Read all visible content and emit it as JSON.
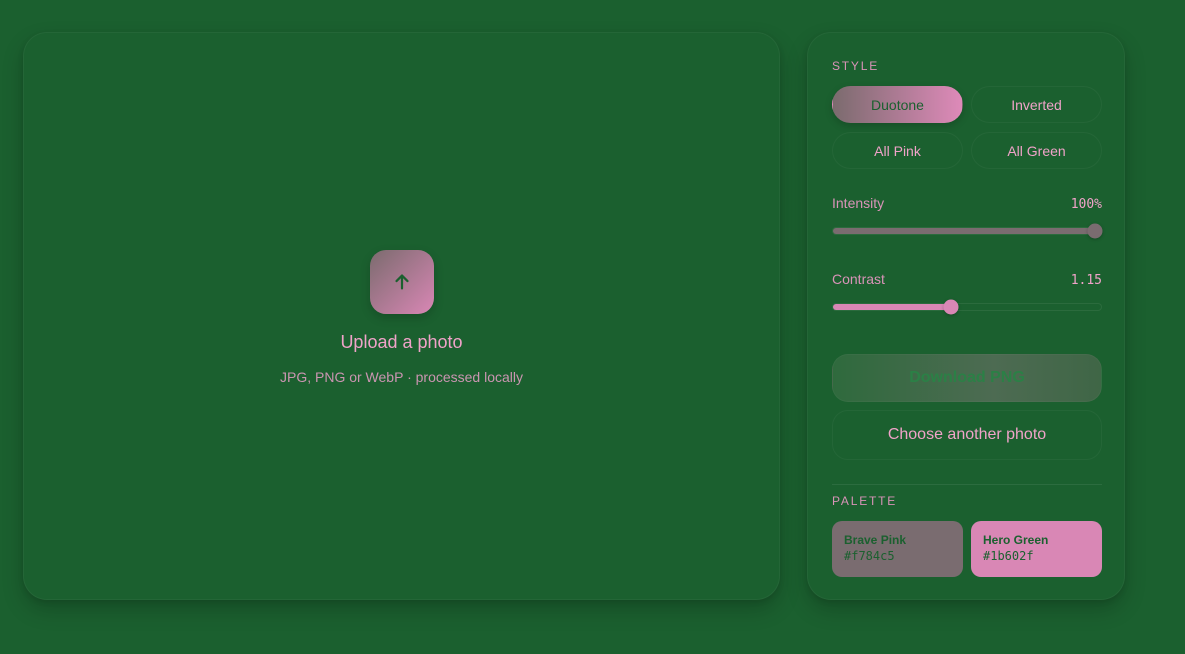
{
  "upload": {
    "title": "Upload a photo",
    "subtitle": "JPG, PNG or WebP · processed locally",
    "icon": "arrow-up-icon"
  },
  "style": {
    "label": "STYLE",
    "options": [
      "Duotone",
      "Inverted",
      "All Pink",
      "All Green"
    ],
    "selected": "Duotone"
  },
  "intensity": {
    "label": "Intensity",
    "value_text": "100%",
    "value_fraction": 1.0
  },
  "contrast": {
    "label": "Contrast",
    "value_text": "1.15",
    "value_fraction": 0.44
  },
  "actions": {
    "download": "Download PNG",
    "choose": "Choose another photo"
  },
  "palette": {
    "label": "PALETTE",
    "swatches": [
      {
        "name": "Brave Pink",
        "hex": "#f784c5"
      },
      {
        "name": "Hero Green",
        "hex": "#1b602f"
      }
    ]
  },
  "colors": {
    "background": "#1b602f",
    "pink_accent": "#f0a3c9",
    "pink_gradient_end": "#de8ab9",
    "grey_gradient_start": "#7b6b6e",
    "muted_track": "#7a6c70"
  }
}
